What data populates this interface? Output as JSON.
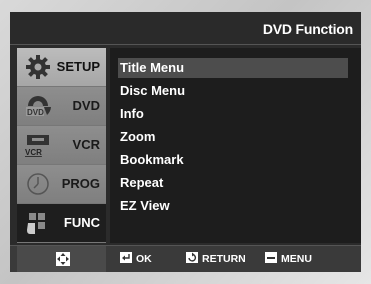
{
  "header": {
    "title": "DVD Function"
  },
  "sidebar": {
    "items": [
      {
        "label": "SETUP",
        "icon": "gear-icon"
      },
      {
        "label": "DVD",
        "icon": "dvd-disc-icon",
        "icon_text": "DVD"
      },
      {
        "label": "VCR",
        "icon": "vcr-icon",
        "icon_text": "VCR"
      },
      {
        "label": "PROG",
        "icon": "clock-icon"
      },
      {
        "label": "FUNC",
        "icon": "function-icon"
      }
    ],
    "selected": "FUNC"
  },
  "menu": {
    "items": [
      "Title Menu",
      "Disc Menu",
      "Info",
      "Zoom",
      "Bookmark",
      "Repeat",
      "EZ View"
    ],
    "highlighted": "Title Menu"
  },
  "footer": {
    "nav_icon": "directional-pad-icon",
    "ok_label": "OK",
    "return_label": "RETURN",
    "menu_label": "MENU"
  },
  "colors": {
    "screen_bg": "#1d1d1d",
    "sidebar_bg": "#a9a9a9",
    "highlight_bg": "#4d4d4d",
    "text": "#ffffff"
  }
}
